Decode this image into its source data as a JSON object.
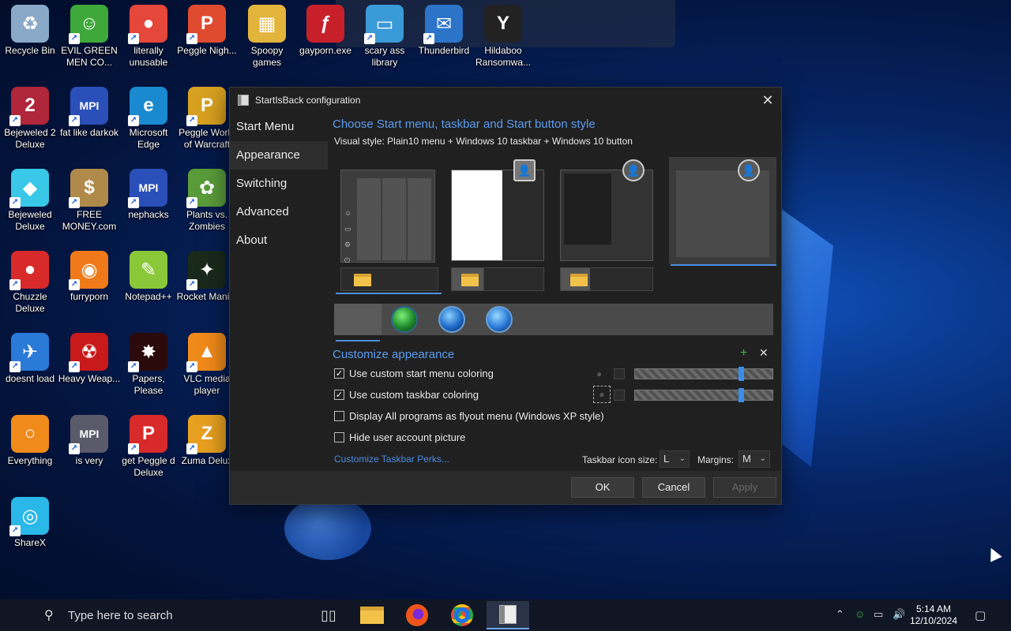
{
  "desktop": {
    "icons": [
      {
        "label": "Recycle Bin",
        "glyph": "♻",
        "color": "#8aa9c8",
        "shortcut": false
      },
      {
        "label": "EVIL GREEN MEN CO...",
        "glyph": "☺",
        "color": "#3fa83a",
        "shortcut": true
      },
      {
        "label": "literally unusable",
        "glyph": "●",
        "color": "#e5473a",
        "shortcut": true
      },
      {
        "label": "Peggle Nigh...",
        "glyph": "P",
        "color": "#e04a2f",
        "shortcut": true
      },
      {
        "label": "Spoopy games",
        "glyph": "▦",
        "color": "#e3b43c",
        "shortcut": false
      },
      {
        "label": "gayporn.exe",
        "glyph": "ƒ",
        "color": "#c8202a",
        "shortcut": false
      },
      {
        "label": "scary ass library",
        "glyph": "▭",
        "color": "#3a9ad8",
        "shortcut": true
      },
      {
        "label": "Thunderbird",
        "glyph": "✉",
        "color": "#2c74c8",
        "shortcut": true
      },
      {
        "label": "Hildaboo Ransomwa...",
        "glyph": "Y",
        "color": "#222",
        "shortcut": false
      },
      {
        "label": "Bejeweled 2 Deluxe",
        "glyph": "2",
        "color": "#b0263a",
        "shortcut": true
      },
      {
        "label": "fat like darkok",
        "glyph": "MPI",
        "color": "#2a4fb8",
        "shortcut": true
      },
      {
        "label": "Microsoft Edge",
        "glyph": "e",
        "color": "#1a8ad0",
        "shortcut": true
      },
      {
        "label": "Peggle World of Warcraft",
        "glyph": "P",
        "color": "#d8a020",
        "shortcut": true
      },
      {
        "label": "Bejeweled Deluxe",
        "glyph": "◆",
        "color": "#39c8e8",
        "shortcut": true
      },
      {
        "label": "FREE MONEY.com",
        "glyph": "$",
        "color": "#b08a4a",
        "shortcut": true
      },
      {
        "label": "nephacks",
        "glyph": "MPI",
        "color": "#2a4fb8",
        "shortcut": true
      },
      {
        "label": "Plants vs. Zombies",
        "glyph": "✿",
        "color": "#5a9c3a",
        "shortcut": true
      },
      {
        "label": "Chuzzle Deluxe",
        "glyph": "●",
        "color": "#d82a2a",
        "shortcut": true
      },
      {
        "label": "furryporn",
        "glyph": "◉",
        "color": "#f07a1a",
        "shortcut": true
      },
      {
        "label": "Notepad++",
        "glyph": "✎",
        "color": "#8ac83a",
        "shortcut": false
      },
      {
        "label": "Rocket Mani...",
        "glyph": "✦",
        "color": "#1a2a1a",
        "shortcut": true
      },
      {
        "label": "doesnt load",
        "glyph": "✈",
        "color": "#2a7ad8",
        "shortcut": true
      },
      {
        "label": "Heavy Weap...",
        "glyph": "☢",
        "color": "#c81a1a",
        "shortcut": true
      },
      {
        "label": "Papers, Please",
        "glyph": "✸",
        "color": "#2a0a0a",
        "shortcut": true
      },
      {
        "label": "VLC media player",
        "glyph": "▲",
        "color": "#f08a1a",
        "shortcut": true
      },
      {
        "label": "Everything",
        "glyph": "○",
        "color": "#f08a1a",
        "shortcut": false
      },
      {
        "label": "is very",
        "glyph": "MPI",
        "color": "#5a5a6a",
        "shortcut": true
      },
      {
        "label": "get Peggle d Deluxe",
        "glyph": "P",
        "color": "#d82a2a",
        "shortcut": true
      },
      {
        "label": "Zuma Delux",
        "glyph": "Z",
        "color": "#e8a020",
        "shortcut": true
      },
      {
        "label": "ShareX",
        "glyph": "◎",
        "color": "#2ab8e8",
        "shortcut": true
      }
    ]
  },
  "dialog": {
    "title": "StartIsBack configuration",
    "nav": [
      "Start Menu",
      "Appearance",
      "Switching",
      "Advanced",
      "About"
    ],
    "active_nav": "Appearance",
    "style_heading": "Choose Start menu, taskbar and Start button style",
    "visual_style": "Visual style:  Plain10 menu + Windows 10 taskbar + Windows 10 button",
    "customize_heading": "Customize appearance",
    "options": [
      {
        "label": "Use custom start menu coloring",
        "checked": true
      },
      {
        "label": "Use custom taskbar coloring",
        "checked": true
      },
      {
        "label": "Display All programs as flyout menu (Windows XP style)",
        "checked": false
      },
      {
        "label": "Hide user account picture",
        "checked": false
      }
    ],
    "sliders": [
      {
        "level": 0.77
      },
      {
        "level": 0.77
      }
    ],
    "perks_link": "Customize Taskbar Perks...",
    "icon_size_label": "Taskbar icon size:",
    "icon_size_value": "L",
    "margins_label": "Margins:",
    "margins_value": "M",
    "buttons": {
      "ok": "OK",
      "cancel": "Cancel",
      "apply": "Apply"
    },
    "accent": "#5a9cf0"
  },
  "taskbar": {
    "search_placeholder": "Type here to search",
    "time": "5:14 AM",
    "date": "12/10/2024"
  }
}
